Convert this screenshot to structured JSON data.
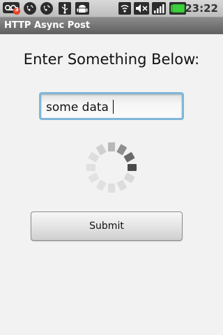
{
  "status_bar": {
    "time": "23:22",
    "notification_badge": "3",
    "icons": [
      "voicemail-icon",
      "phone-call-icon",
      "phone-missed-icon",
      "usb-icon",
      "android-debug-icon",
      "wifi-icon",
      "mute-icon",
      "signal-icon",
      "battery-icon"
    ],
    "battery_color": "#3ecf3e"
  },
  "title_bar": {
    "title": "HTTP Async Post"
  },
  "main": {
    "prompt": "Enter Something Below:",
    "input_value": "some data",
    "progress_spinner": {
      "label": "loading"
    },
    "submit_label": "Submit"
  }
}
